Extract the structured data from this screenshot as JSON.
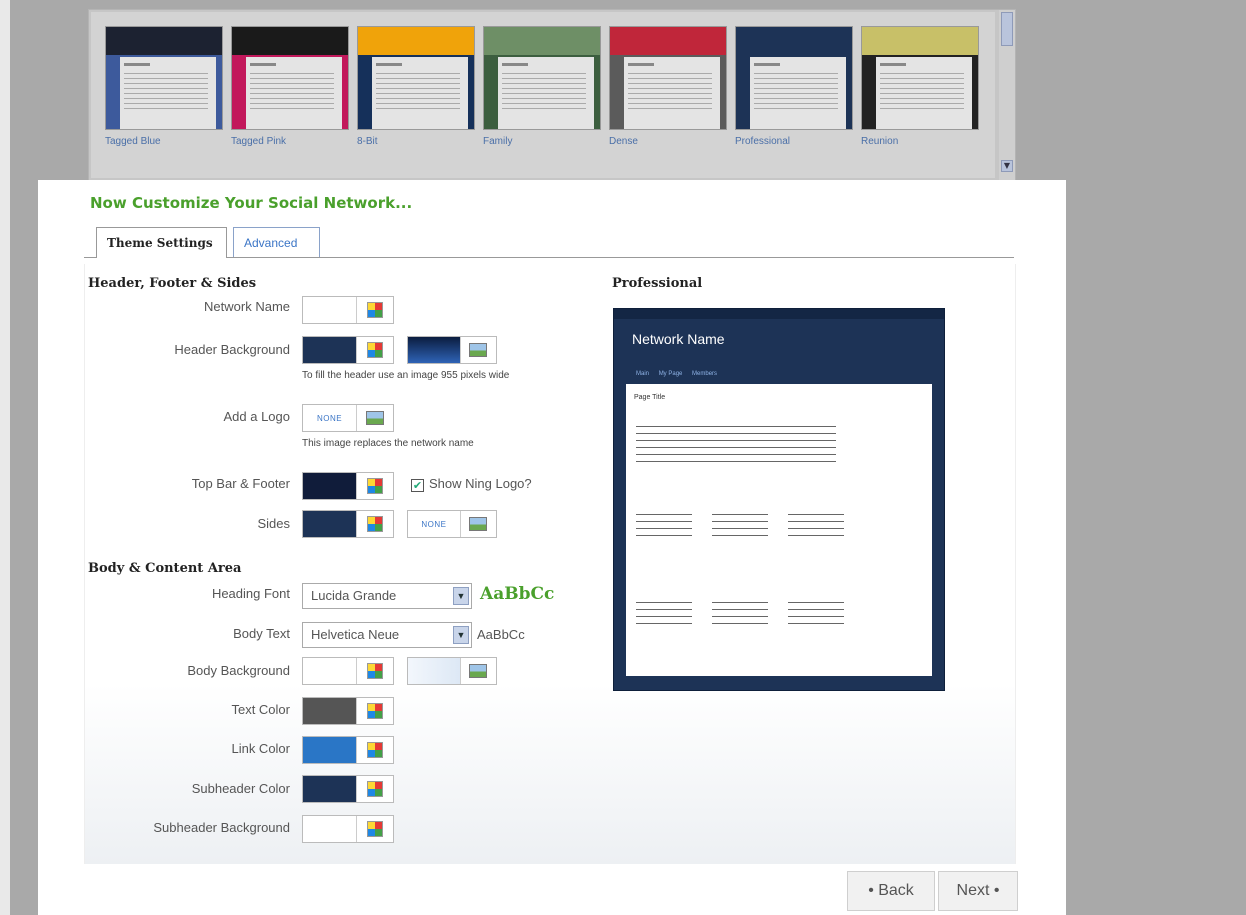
{
  "themes": [
    {
      "label": "Tagged Blue",
      "top": "#1c2231",
      "side": "#3d5a9c"
    },
    {
      "label": "Tagged Pink",
      "top": "#1a1a1a",
      "side": "#c2185b"
    },
    {
      "label": "8-Bit",
      "top": "#f0a30a",
      "side": "#15305a"
    },
    {
      "label": "Family",
      "top": "#6e8f66",
      "side": "#3c5e3f"
    },
    {
      "label": "Dense",
      "top": "#c0263a",
      "side": "#5b5b5b"
    },
    {
      "label": "Professional",
      "top": "#1d3356",
      "side": "#1d3356"
    },
    {
      "label": "Reunion",
      "top": "#c8c068",
      "side": "#222222"
    }
  ],
  "main": {
    "title": "Now Customize Your Social Network...",
    "tabs": [
      "Theme Settings",
      "Advanced"
    ]
  },
  "header_section": {
    "title": "Header, Footer & Sides",
    "network_name_label": "Network Name",
    "header_bg_label": "Header Background",
    "header_bg_hint": "To fill the header use an image 955 pixels wide",
    "logo_label": "Add a Logo",
    "logo_value": "NONE",
    "logo_hint": "This image replaces the network name",
    "topbar_label": "Top Bar & Footer",
    "show_ning_logo_label": "Show Ning Logo?",
    "sides_label": "Sides",
    "sides_image_value": "NONE"
  },
  "body_section": {
    "title": "Body & Content Area",
    "heading_font_label": "Heading Font",
    "heading_font_value": "Lucida Grande",
    "heading_font_sample": "AaBbCc",
    "body_text_label": "Body Text",
    "body_text_value": "Helvetica Neue",
    "body_text_sample": "AaBbCc",
    "body_bg_label": "Body Background",
    "text_color_label": "Text Color",
    "link_color_label": "Link Color",
    "subheader_color_label": "Subheader Color",
    "subheader_bg_label": "Subheader Background"
  },
  "colors": {
    "network_name": "#ffffff",
    "header_background": "#1d3356",
    "top_bar_footer": "#101c3a",
    "sides": "#1d3356",
    "body_background": "#ffffff",
    "text": "#555555",
    "link": "#2a76c6",
    "subheader": "#1d3356",
    "subheader_background": "#ffffff",
    "title_green": "#4aa02c"
  },
  "preview": {
    "title": "Professional",
    "network_name": "Network Name",
    "nav": [
      "Main",
      "My Page",
      "Members"
    ],
    "page_title": "Page Title"
  },
  "footer": {
    "back_label": "• Back",
    "next_label": "Next •"
  }
}
